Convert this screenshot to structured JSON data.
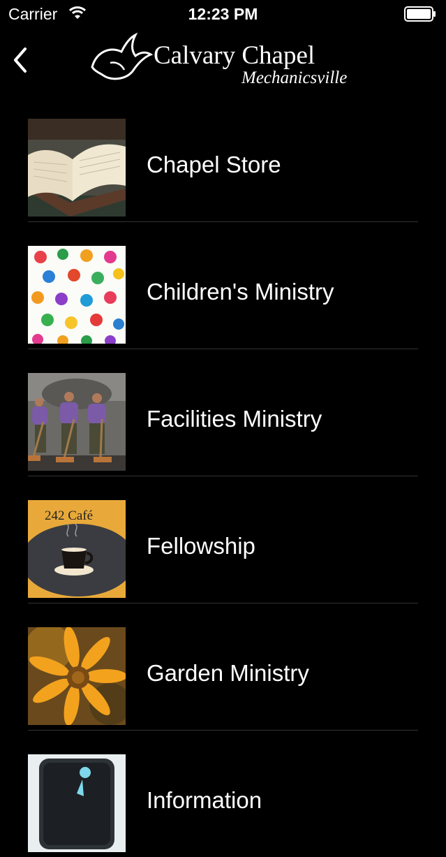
{
  "status": {
    "carrier": "Carrier",
    "time": "12:23 PM"
  },
  "nav": {
    "logo_title": "Calvary Chapel",
    "logo_subtitle": "Mechanicsville"
  },
  "items": [
    {
      "label": "Chapel Store"
    },
    {
      "label": "Children's Ministry"
    },
    {
      "label": "Facilities Ministry"
    },
    {
      "label": "Fellowship",
      "thumb_text": "242 Café"
    },
    {
      "label": "Garden Ministry"
    },
    {
      "label": "Information"
    }
  ]
}
